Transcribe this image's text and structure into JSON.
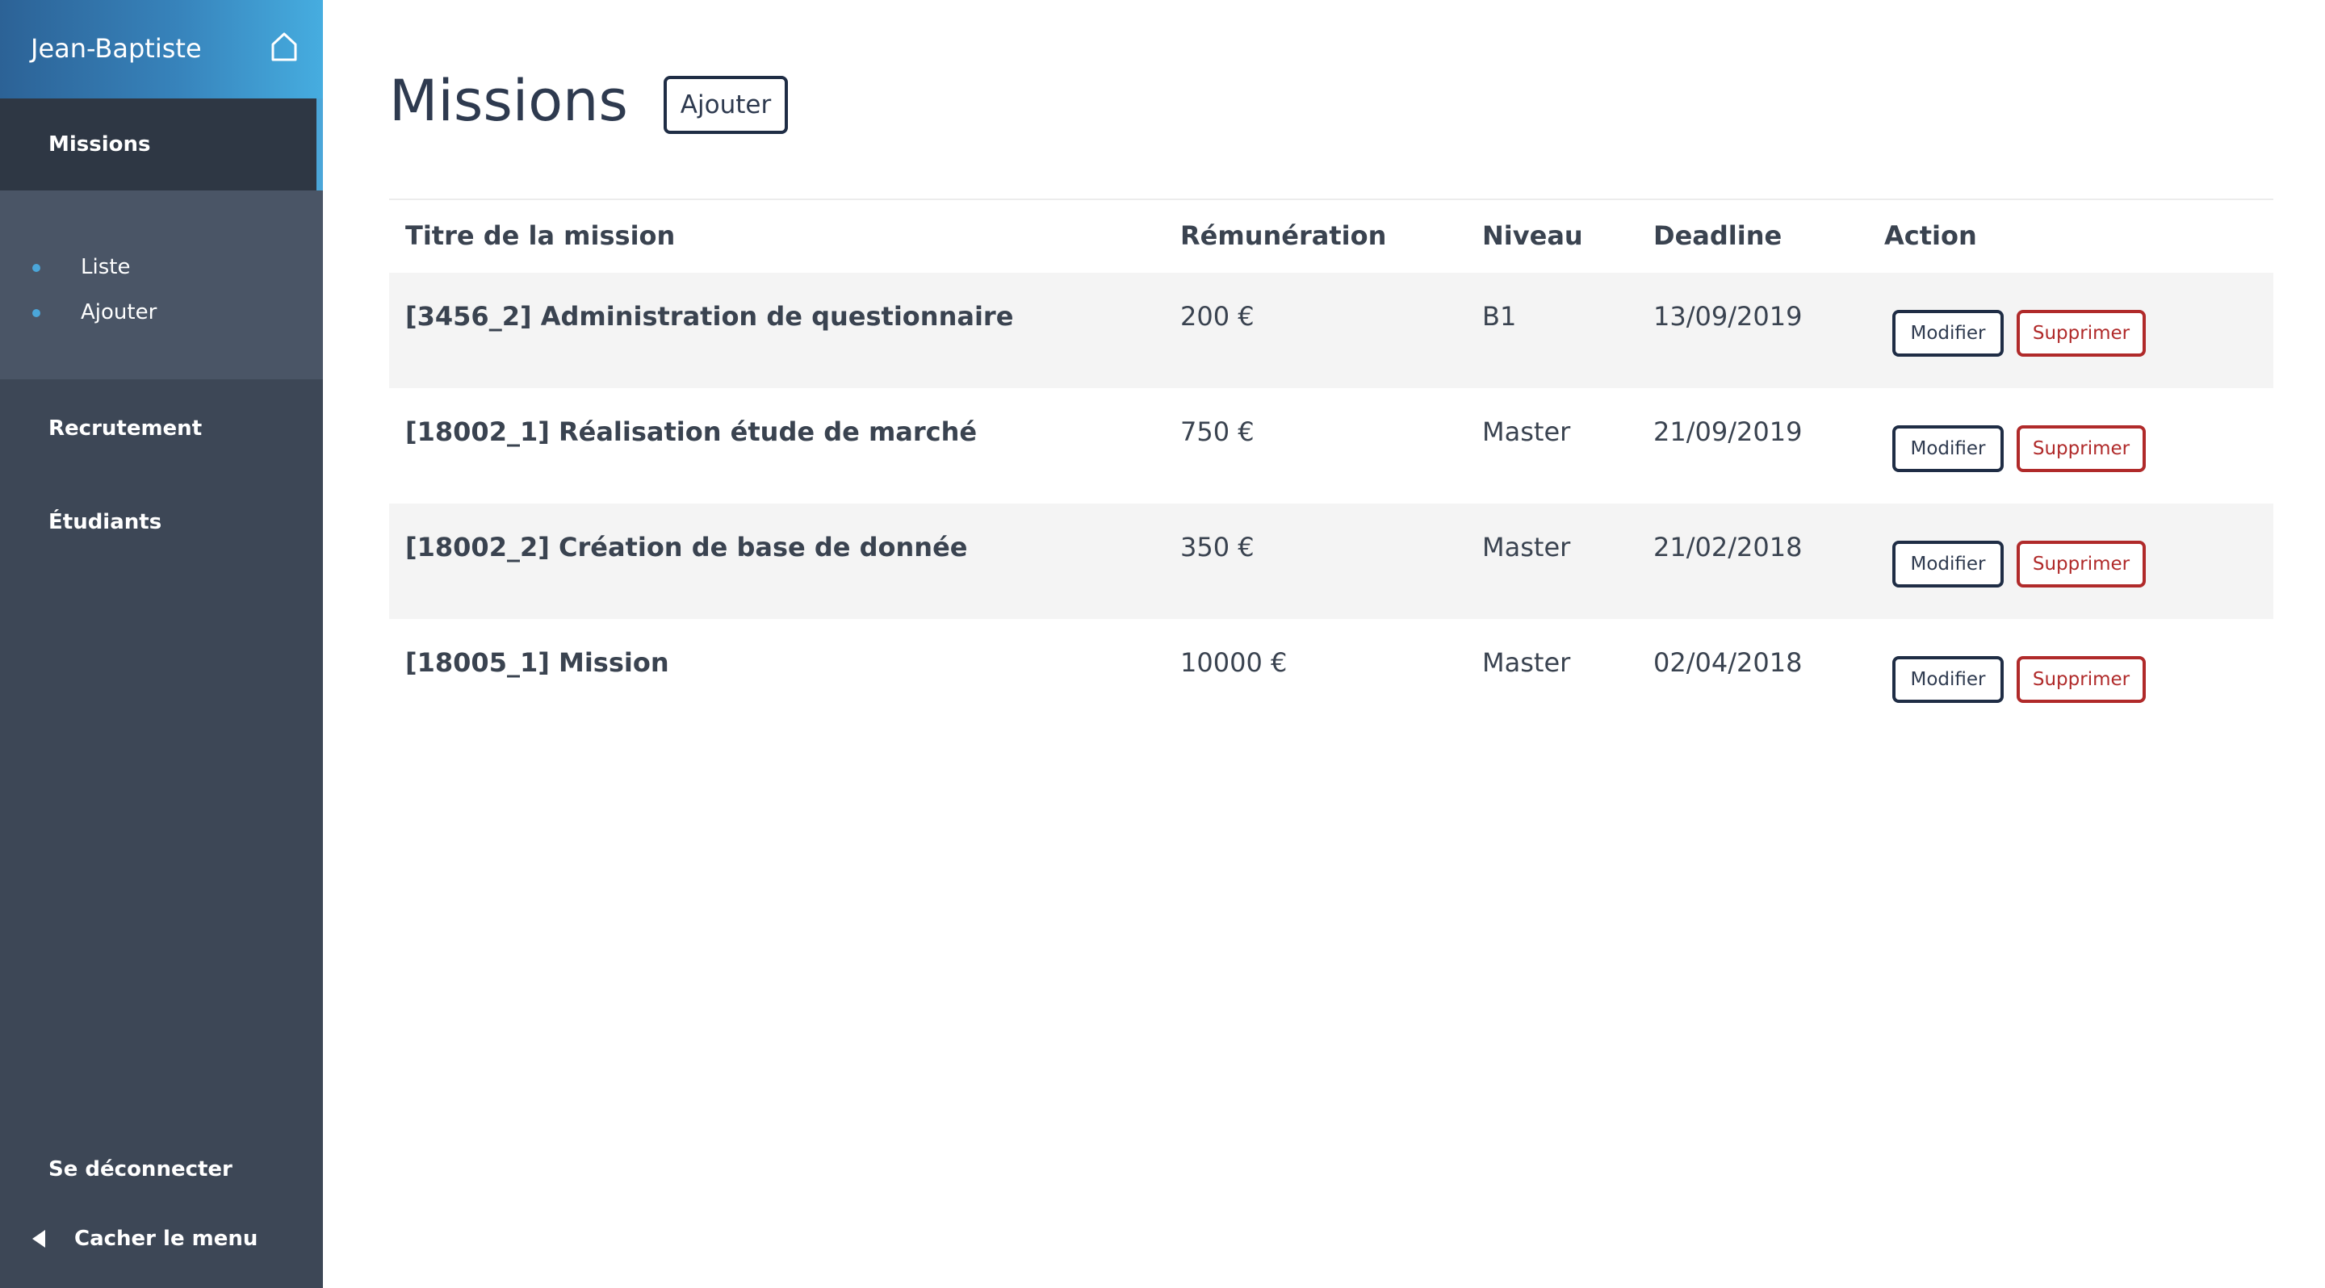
{
  "sidebar": {
    "user_name": "Jean-Baptiste",
    "home_icon": "home-icon",
    "active_section": "Missions",
    "submenu": [
      {
        "label": "Liste"
      },
      {
        "label": "Ajouter"
      }
    ],
    "items": [
      {
        "label": "Recrutement"
      },
      {
        "label": "Étudiants"
      }
    ],
    "logout_label": "Se déconnecter",
    "hide_menu_label": "Cacher le menu",
    "accent_color": "#4ba6d9"
  },
  "main": {
    "title": "Missions",
    "add_button_label": "Ajouter",
    "table": {
      "headers": [
        "Titre de la mission",
        "Rémunération",
        "Niveau",
        "Deadline",
        "Action"
      ],
      "rows": [
        {
          "title": "[3456_2] Administration de questionnaire",
          "pay": "200 €",
          "level": "B1",
          "deadline": "13/09/2019"
        },
        {
          "title": "[18002_1] Réalisation étude de marché",
          "pay": "750 €",
          "level": "Master",
          "deadline": "21/09/2019"
        },
        {
          "title": "[18002_2] Création de base de donnée",
          "pay": "350 €",
          "level": "Master",
          "deadline": "21/02/2018"
        },
        {
          "title": "[18005_1] Mission",
          "pay": "10000 €",
          "level": "Master",
          "deadline": "02/04/2018"
        }
      ],
      "edit_label": "Modifier",
      "delete_label": "Supprimer",
      "delete_color": "#b02a2a"
    }
  }
}
